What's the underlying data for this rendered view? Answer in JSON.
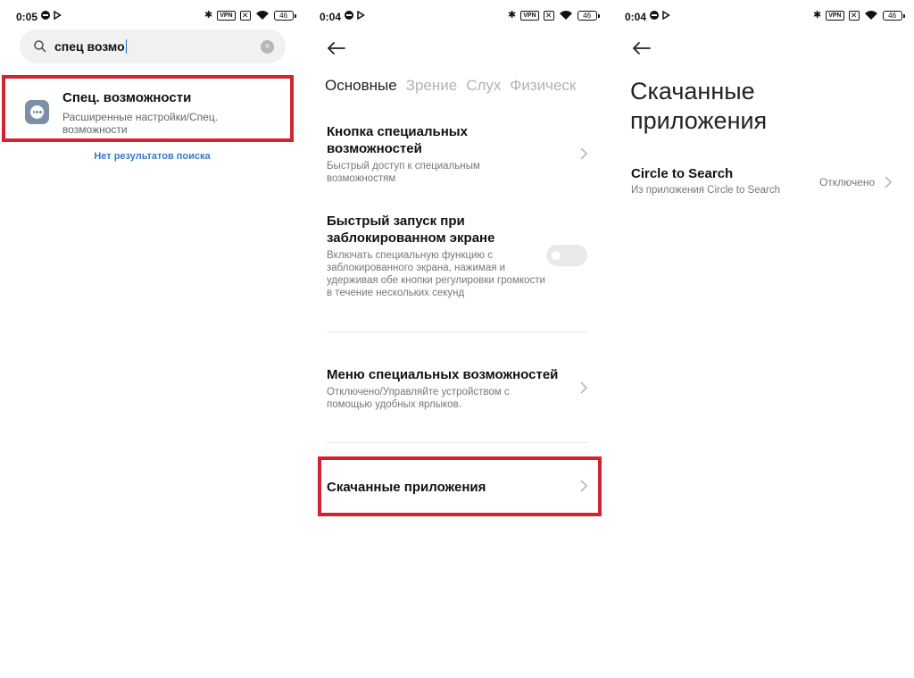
{
  "screen1": {
    "status": {
      "time": "0:05",
      "battery": "46"
    },
    "search": {
      "query": "спец возмо"
    },
    "result": {
      "title": "Спец. возможности",
      "subtitle": "Расширенные настройки/Спец. возможности"
    },
    "no_results": "Нет результатов поиска"
  },
  "screen2": {
    "status": {
      "time": "0:04",
      "battery": "46"
    },
    "tabs": [
      {
        "label": "Основные",
        "active": true
      },
      {
        "label": "Зрение",
        "active": false
      },
      {
        "label": "Слух",
        "active": false
      },
      {
        "label": "Физическ",
        "active": false
      }
    ],
    "items": [
      {
        "title": "Кнопка специальных возможностей",
        "subtitle": "Быстрый доступ к специальным возможностям"
      },
      {
        "title": "Быстрый запуск при заблокированном экране",
        "subtitle": "Включать специальную функцию с заблокированного экрана, нажимая и удерживая обе кнопки регулировки громкости в течение нескольких секунд",
        "toggle_on": false
      },
      {
        "title": "Меню специальных возможностей",
        "subtitle": "Отключено/Управляйте устройством с помощью удобных ярлыков."
      },
      {
        "title": "Скачанные приложения"
      }
    ]
  },
  "screen3": {
    "status": {
      "time": "0:04",
      "battery": "46"
    },
    "title": "Скачанные приложения",
    "item": {
      "title": "Circle to Search",
      "subtitle": "Из приложения Circle to Search",
      "value": "Отключено"
    }
  },
  "status_icons": {
    "vpn": "VPN",
    "bluetooth": "✱",
    "sim": "✕"
  },
  "colors": {
    "highlight": "#d3232f",
    "link": "#3a78c2",
    "app_icon": "#7b8fa6"
  }
}
